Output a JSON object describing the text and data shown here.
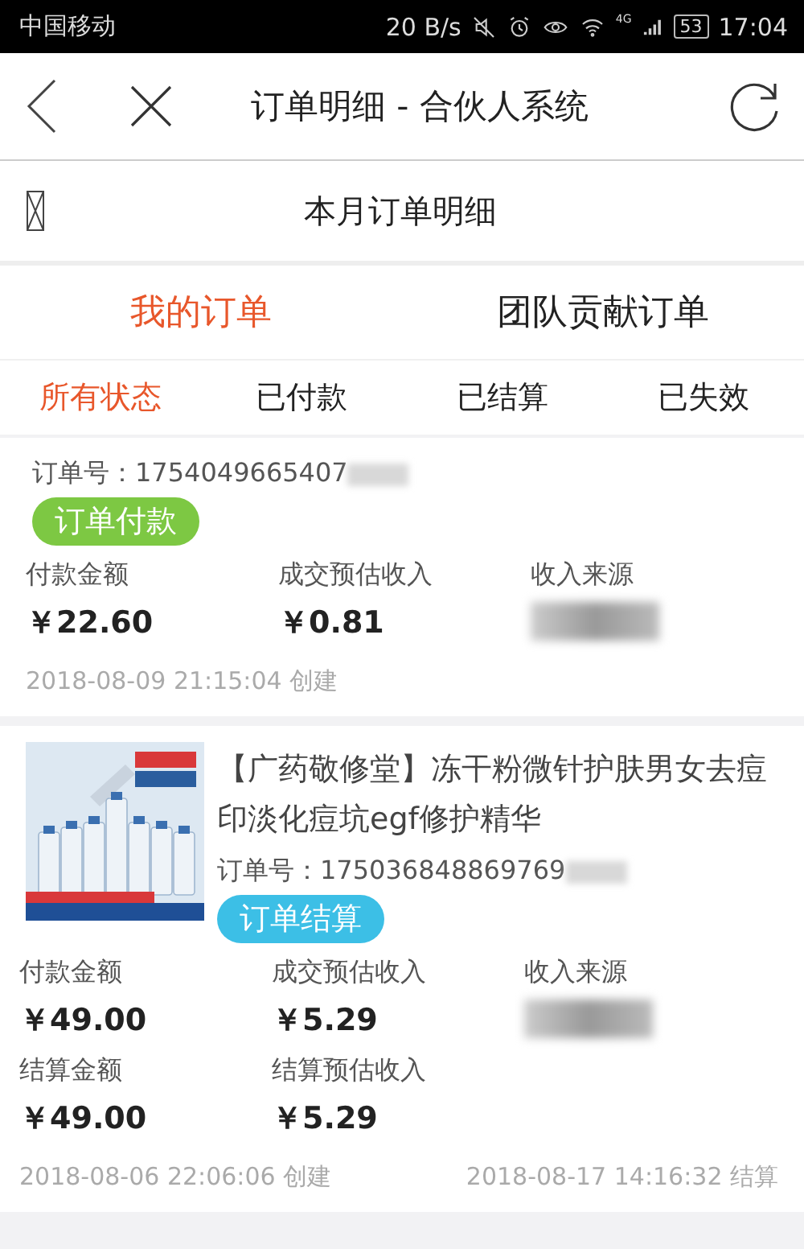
{
  "status_bar": {
    "carrier": "中国移动",
    "speed": "20 B/s",
    "network": "4G",
    "battery": "53",
    "time": "17:04"
  },
  "nav": {
    "title": "订单明细 - 合伙人系统"
  },
  "section": {
    "title": "本月订单明细"
  },
  "tabs": [
    {
      "label": "我的订单",
      "selected": true
    },
    {
      "label": "团队贡献订单",
      "selected": false
    }
  ],
  "filters": [
    {
      "label": "所有状态",
      "selected": true
    },
    {
      "label": "已付款",
      "selected": false
    },
    {
      "label": "已结算",
      "selected": false
    },
    {
      "label": "已失效",
      "selected": false
    }
  ],
  "orders": [
    {
      "order_no": "订单号：1754049665407",
      "status": {
        "label": "订单付款",
        "color": "#7dc843"
      },
      "fields": [
        [
          {
            "label": "付款金额",
            "value": "￥22.60"
          },
          {
            "label": "成交预估收入",
            "value": "￥0.81"
          },
          {
            "label": "收入来源",
            "redacted": true
          }
        ]
      ],
      "created": "2018-08-09 21:15:04 创建"
    },
    {
      "product": {
        "kind": "picture",
        "title": "【广药敬修堂】冻干粉微针护肤男女去痘印淡化痘坑egf修护精华"
      },
      "order_no": "订单号：175036848869769",
      "status": {
        "label": "订单结算",
        "color": "#3cbfe6"
      },
      "fields": [
        [
          {
            "label": "付款金额",
            "value": "￥49.00"
          },
          {
            "label": "成交预估收入",
            "value": "￥5.29"
          },
          {
            "label": "收入来源",
            "redacted": true
          }
        ],
        [
          {
            "label": "结算金额",
            "value": "￥49.00"
          },
          {
            "label": "结算预估收入",
            "value": "￥5.29"
          }
        ]
      ],
      "created": "2018-08-06 22:06:06 创建",
      "settled": "2018-08-17 14:16:32 结算"
    }
  ]
}
